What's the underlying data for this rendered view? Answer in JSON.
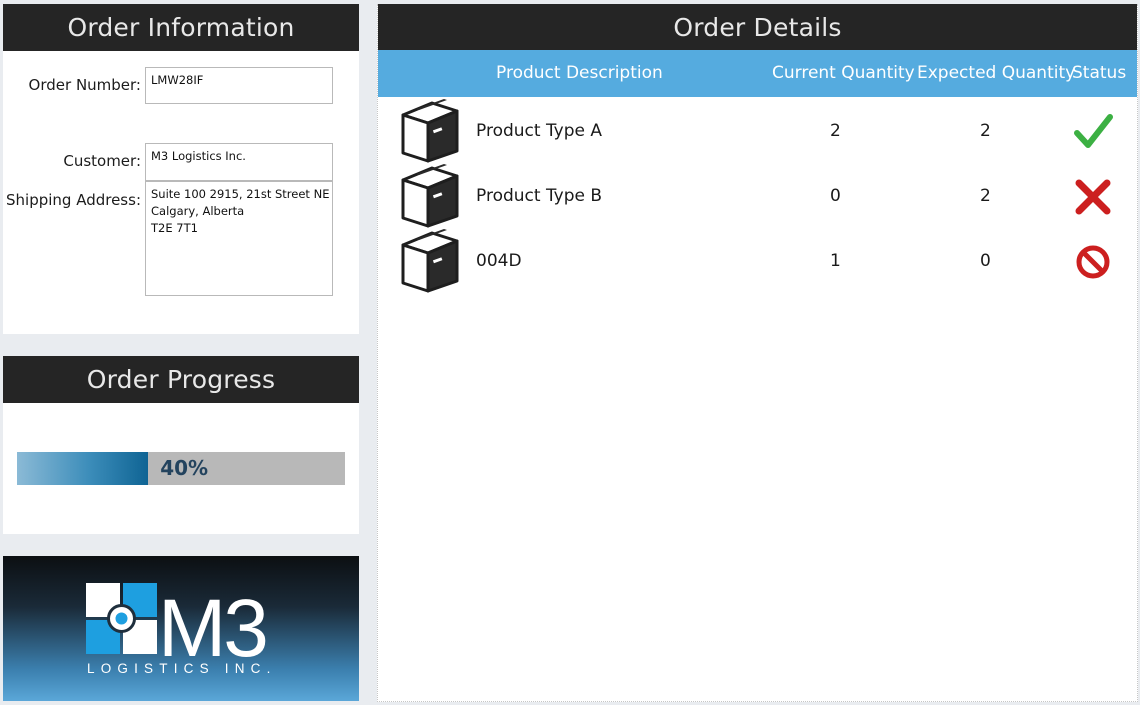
{
  "order_info": {
    "title": "Order Information",
    "order_number_label": "Order Number:",
    "order_number": "LMW28IF",
    "customer_label": "Customer:",
    "customer": "M3 Logistics Inc.",
    "shipping_label": "Shipping Address:",
    "shipping_lines": [
      "Suite 100 2915, 21st Street NE",
      "Calgary, Alberta",
      "T2E 7T1"
    ]
  },
  "order_progress": {
    "title": "Order Progress",
    "percent": 40,
    "percent_text": "40%"
  },
  "logo": {
    "brand": "M3",
    "tagline": "LOGISTICS INC."
  },
  "order_details": {
    "title": "Order Details",
    "columns": [
      "Product Description",
      "Current Quantity",
      "Expected Quantity",
      "Status"
    ],
    "rows": [
      {
        "description": "Product Type A",
        "current": "2",
        "expected": "2",
        "status": "check-icon"
      },
      {
        "description": "Product Type B",
        "current": "0",
        "expected": "2",
        "status": "cross-icon"
      },
      {
        "description": "004D",
        "current": "1",
        "expected": "0",
        "status": "prohibited-icon"
      }
    ]
  },
  "colors": {
    "header_dark": "#252525",
    "table_header_blue": "#55abdf",
    "check_green": "#3cb043",
    "cross_red": "#cc1f1f"
  }
}
